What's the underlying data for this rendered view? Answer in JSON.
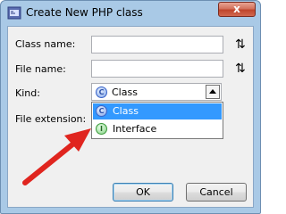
{
  "window": {
    "title": "Create New PHP class",
    "close_label": "x"
  },
  "form": {
    "class_name": {
      "label": "Class name:",
      "value": ""
    },
    "file_name": {
      "label": "File name:",
      "value": ""
    },
    "kind": {
      "label": "Kind:",
      "selected": "Class",
      "selected_icon_letter": "C"
    },
    "file_extension": {
      "label": "File extension:"
    },
    "sort_glyph": "⇅"
  },
  "dropdown": {
    "items": [
      {
        "label": "Class",
        "icon_letter": "C",
        "selected": true
      },
      {
        "label": "Interface",
        "icon_letter": "I",
        "selected": false
      }
    ]
  },
  "buttons": {
    "ok": "OK",
    "cancel": "Cancel"
  },
  "annotation": {
    "arrow_color": "#e0251f"
  }
}
